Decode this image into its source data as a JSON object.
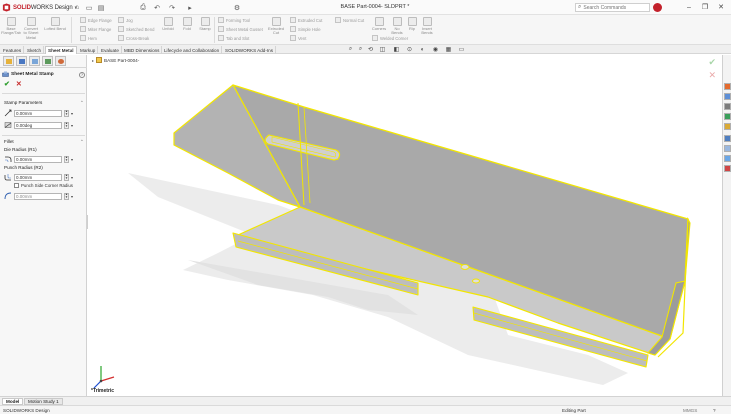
{
  "app": {
    "brand_prefix": "SOLID",
    "brand_suffix": "WORKS Design",
    "caret": "▾"
  },
  "title_bar": {
    "document_title": "BASE Part-0004- SLDPRT *",
    "search_placeholder": "Search Commands",
    "avatar_initial": "",
    "minimize": "–",
    "restore": "❐",
    "close": "✕"
  },
  "quick_access": [
    "⌂",
    "▭",
    "▤",
    "⎙",
    "↶",
    "↷",
    "▸",
    "⚙"
  ],
  "ribbon": {
    "large_buttons": [
      {
        "id": "base-flange",
        "label": "Base\nFlange/Tab"
      },
      {
        "id": "convert-sheet-metal",
        "label": "Convert\nto Sheet\nMetal"
      },
      {
        "id": "lofted-bend",
        "label": "Lofted Bend"
      },
      {
        "id": "flatten",
        "label": "Flatten"
      },
      {
        "id": "no-bends",
        "label": "No\nBends"
      },
      {
        "id": "rip",
        "label": "Rip"
      },
      {
        "id": "insert-bends",
        "label": "Insert\nBends"
      }
    ],
    "small_buttons": [
      [
        "Edge Flange",
        "Miter Flange",
        "Hem"
      ],
      [
        "Jog",
        "Sketched Bend",
        "Cross-Break"
      ],
      [
        "Extruded Cut",
        "Simple Hole",
        "Vent"
      ],
      [
        "Corners",
        "Welded Corner",
        "Break-Corner"
      ],
      [
        "Forming Tool",
        "Sheet Metal Gusset",
        "Tab and Slot"
      ],
      [
        "Extruded Cut",
        "Normal Cut",
        "Unfold",
        "Fold"
      ]
    ],
    "mid_buttons": [
      {
        "id": "unfold",
        "label": "Unfold"
      },
      {
        "id": "fold",
        "label": "Fold"
      },
      {
        "id": "stamp",
        "label": "Stamp"
      }
    ]
  },
  "tabs": [
    {
      "label": "Features",
      "active": false
    },
    {
      "label": "Sketch",
      "active": false
    },
    {
      "label": "Sheet Metal",
      "active": true
    },
    {
      "label": "Markup",
      "active": false
    },
    {
      "label": "Evaluate",
      "active": false
    },
    {
      "label": "MBD Dimensions",
      "active": false
    },
    {
      "label": "Lifecycle and Collaboration",
      "active": false
    },
    {
      "label": "SOLIDWORKS Add-Ins",
      "active": false
    }
  ],
  "heads_up_icons": [
    "⌕",
    "⌕",
    "⟲",
    "◫",
    "◧",
    "⊙",
    "◐",
    "◉",
    "▦",
    "▭"
  ],
  "property_manager": {
    "title": "Sheet Metal Stamp",
    "help": "?",
    "ok": "✔",
    "cancel": "✕",
    "stamp_parameters": {
      "heading": "Stamp Parameters",
      "field1_value": "0.00mm",
      "field2_value": "0.00deg"
    },
    "fillet": {
      "heading": "Fillet",
      "die_radius_label": "Die Radius (R1)",
      "die_radius_value": "0.00mm",
      "punch_radius_label": "Punch Radius (R2)",
      "punch_radius_value": "0.00mm",
      "punch_corner_label": "Punch Side Corner Radius",
      "punch_corner_value": "0.00mm"
    }
  },
  "viewport": {
    "tree_node": "BASE Part-0004-",
    "view_label": "*Trimetric",
    "ok": "✔",
    "cancel": "✕"
  },
  "bottom_tabs": [
    {
      "label": "Model",
      "active": true
    },
    {
      "label": "Motion Study 1",
      "active": false
    }
  ],
  "status_bar": {
    "left": "SOLIDWORKS Design",
    "mode": "Editing Part",
    "units": "MMGS"
  },
  "colors": {
    "edge_highlight": "#f2e600",
    "face_gray": "#a6a6a6",
    "shadow": "#e9e9e9",
    "brand": "#c3212b"
  }
}
